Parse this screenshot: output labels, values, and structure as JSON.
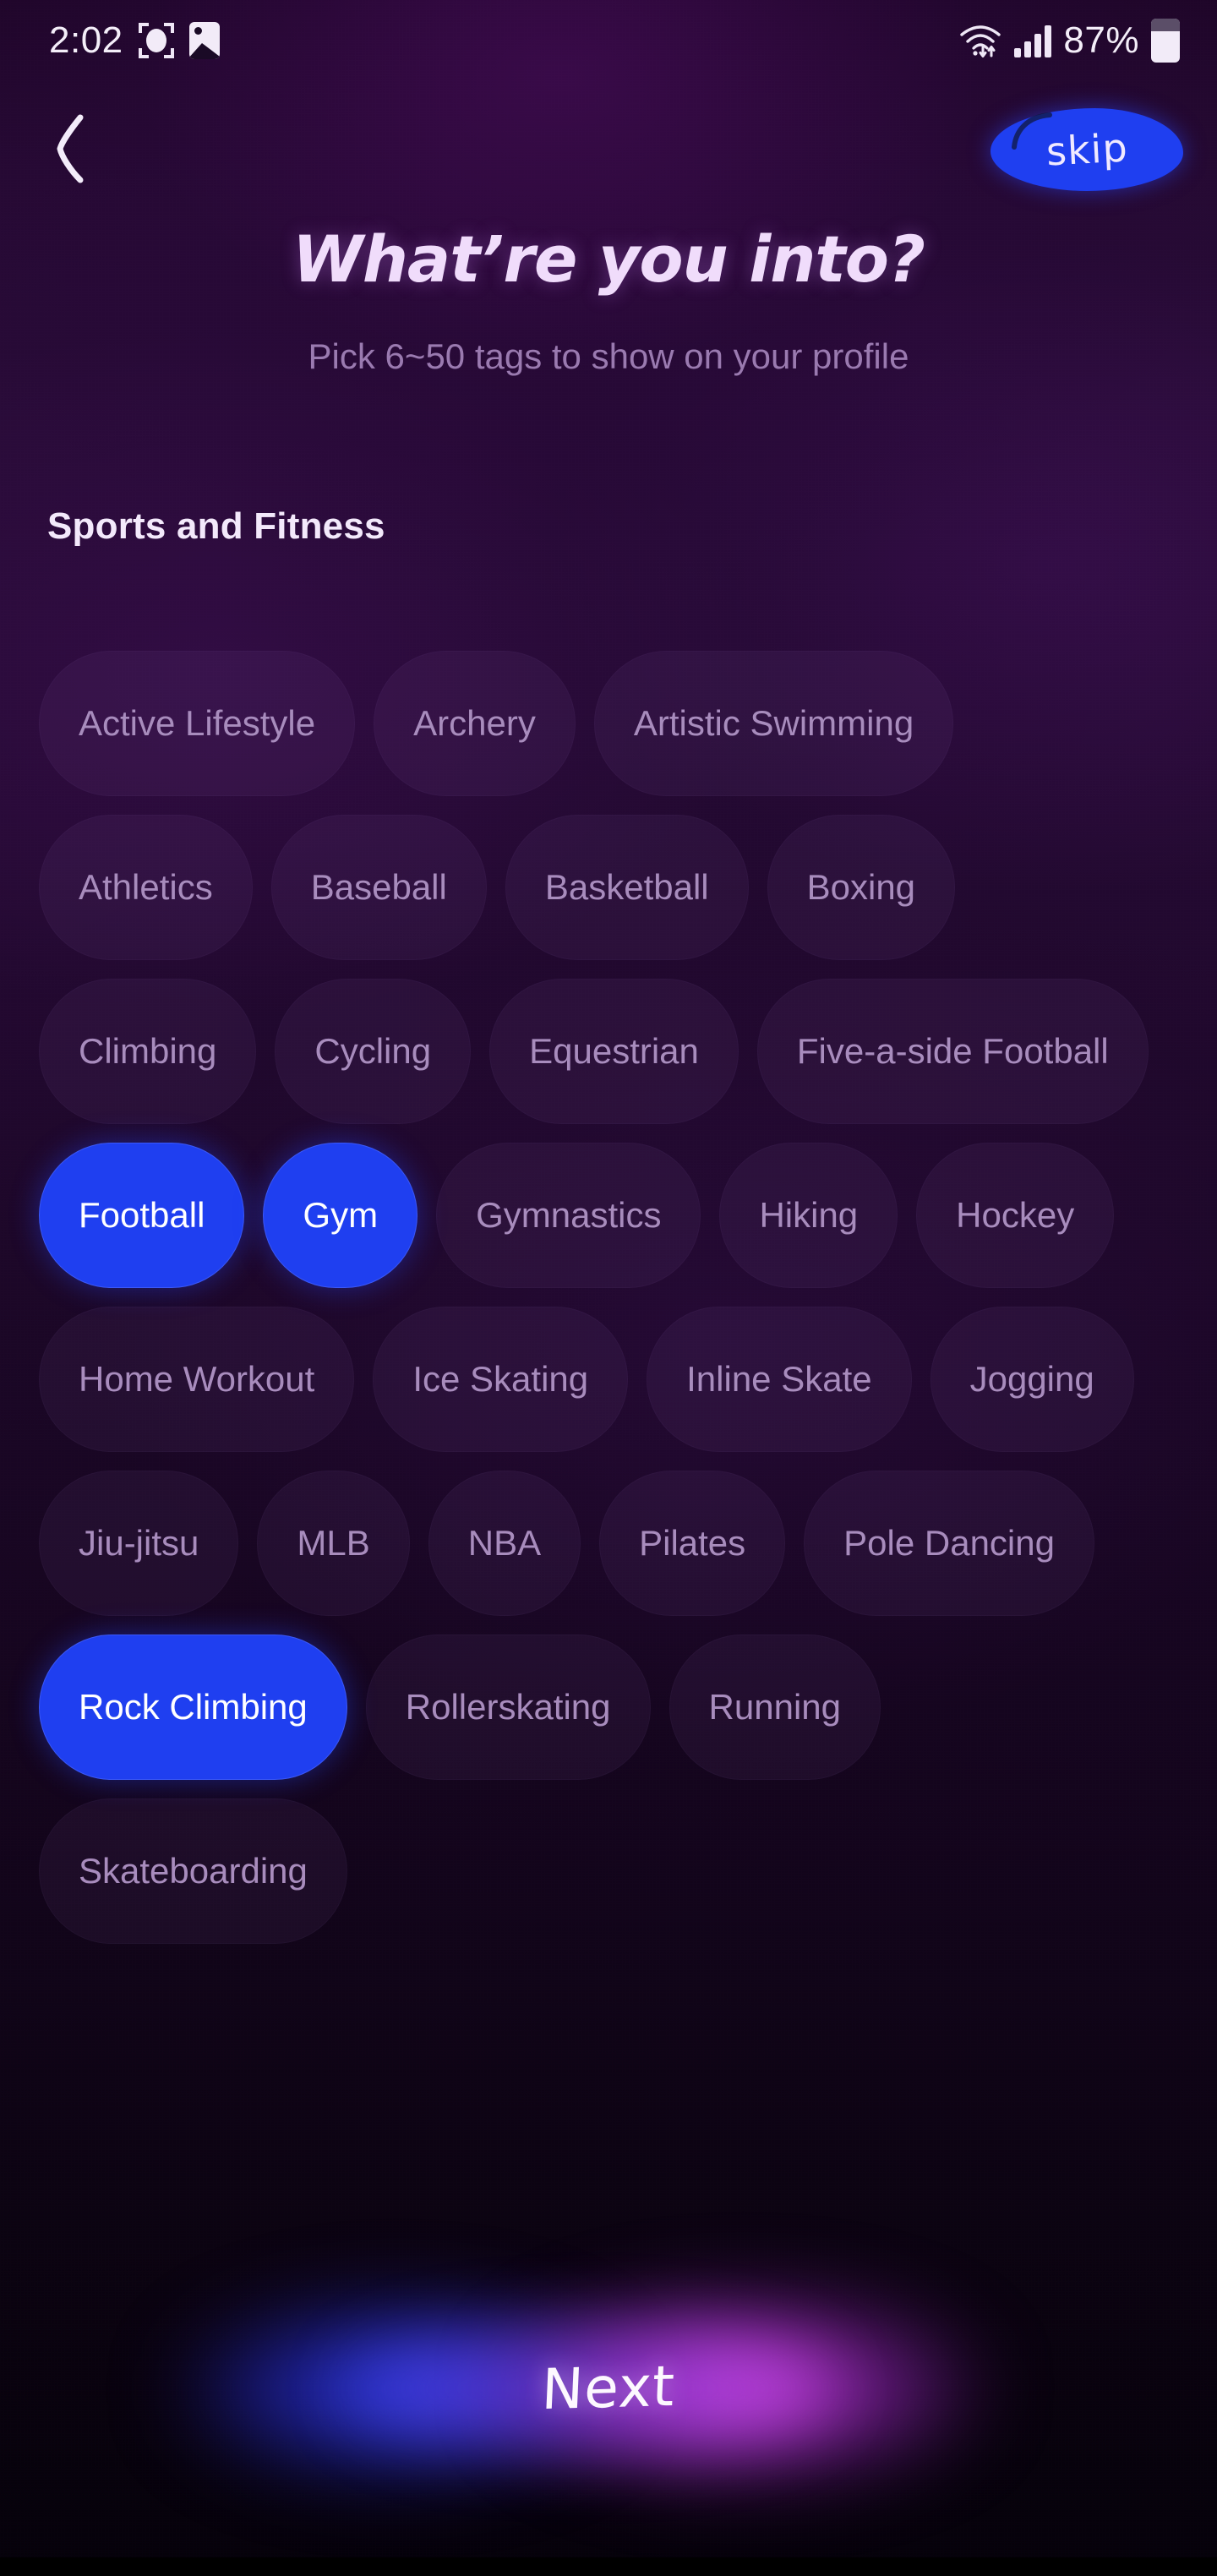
{
  "status_bar": {
    "time": "2:02",
    "battery_percent": "87%",
    "icons": [
      "screenshot-capture-icon",
      "gallery-image-icon",
      "wifi-icon",
      "cellular-signal-icon",
      "battery-icon"
    ]
  },
  "header": {
    "back_label": "‹",
    "skip_label": "skip"
  },
  "page": {
    "title": "What’re you into?",
    "subtitle": "Pick 6~50 tags to show on your profile"
  },
  "section": {
    "heading": "Sports and Fitness"
  },
  "tags": [
    {
      "label": "Active Lifestyle",
      "selected": false
    },
    {
      "label": "Archery",
      "selected": false
    },
    {
      "label": "Artistic Swimming",
      "selected": false
    },
    {
      "label": "Athletics",
      "selected": false
    },
    {
      "label": "Baseball",
      "selected": false
    },
    {
      "label": "Basketball",
      "selected": false
    },
    {
      "label": "Boxing",
      "selected": false
    },
    {
      "label": "Climbing",
      "selected": false
    },
    {
      "label": "Cycling",
      "selected": false
    },
    {
      "label": "Equestrian",
      "selected": false
    },
    {
      "label": "Five-a-side Football",
      "selected": false
    },
    {
      "label": "Football",
      "selected": true
    },
    {
      "label": "Gym",
      "selected": true
    },
    {
      "label": "Gymnastics",
      "selected": false
    },
    {
      "label": "Hiking",
      "selected": false
    },
    {
      "label": "Hockey",
      "selected": false
    },
    {
      "label": "Home Workout",
      "selected": false
    },
    {
      "label": "Ice Skating",
      "selected": false
    },
    {
      "label": "Inline Skate",
      "selected": false
    },
    {
      "label": "Jogging",
      "selected": false
    },
    {
      "label": "Jiu-jitsu",
      "selected": false
    },
    {
      "label": "MLB",
      "selected": false
    },
    {
      "label": "NBA",
      "selected": false
    },
    {
      "label": "Pilates",
      "selected": false
    },
    {
      "label": "Pole Dancing",
      "selected": false
    },
    {
      "label": "Rock Climbing",
      "selected": true
    },
    {
      "label": "Rollerskating",
      "selected": false
    },
    {
      "label": "Running",
      "selected": false
    },
    {
      "label": "Skateboarding",
      "selected": false
    }
  ],
  "footer": {
    "next_label": "Next"
  },
  "colors": {
    "accent_blue": "#1f3ff0",
    "glow_blue": "#3a48ff",
    "glow_magenta": "#e248ff",
    "title_text": "#f0dcfb",
    "subtitle_text": "#9a7ab0",
    "tag_text": "#a88cbd",
    "selected_tag_text": "#ffffff",
    "background_top": "#2b0c3a",
    "background_bottom": "#05010a"
  }
}
